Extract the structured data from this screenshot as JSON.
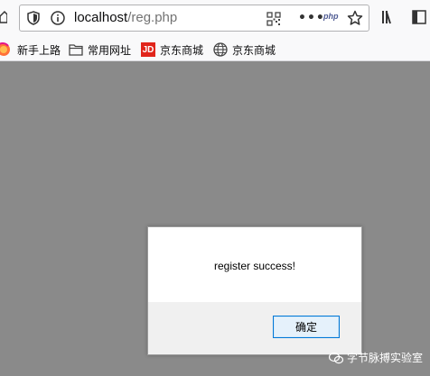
{
  "browser": {
    "url_host": "localhost",
    "url_path": "/reg.php",
    "php_badge": "php"
  },
  "bookmarks": [
    {
      "label": "新手上路",
      "icon": "firefox-icon"
    },
    {
      "label": "常用网址",
      "icon": "folder-icon"
    },
    {
      "label": "京东商城",
      "icon": "jd-icon"
    },
    {
      "label": "京东商城",
      "icon": "globe-icon"
    }
  ],
  "jd_logo_text": "JD",
  "dialog": {
    "message": "register success!",
    "ok_label": "确定"
  },
  "watermark": {
    "text": "字节脉搏实验室"
  },
  "colors": {
    "page_background": "#8a8a8a",
    "dialog_button_border": "#0078d7",
    "jd_red": "#e1251b"
  }
}
